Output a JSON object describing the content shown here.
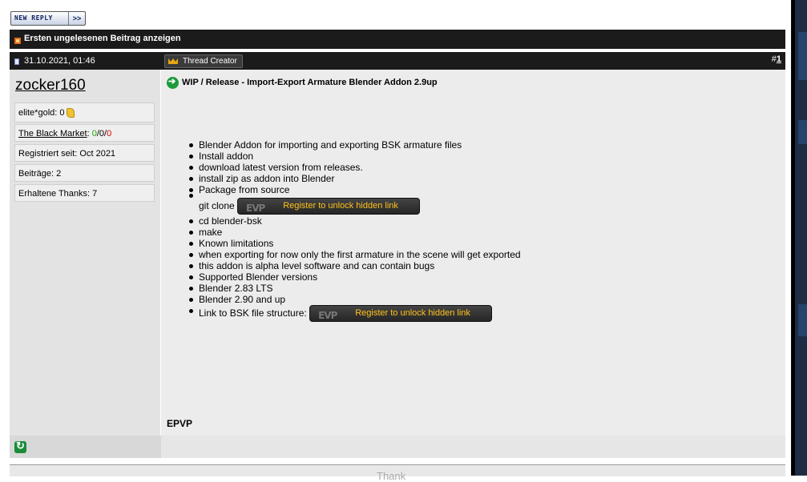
{
  "toolbar": {
    "new_reply_label": "NEW REPLY",
    "new_reply_arrow": ">>"
  },
  "unread_bar": {
    "label": "Ersten ungelesenen Beitrag anzeigen"
  },
  "post": {
    "date": "31.10.2021, 01:46",
    "badge": "Thread Creator",
    "number_prefix": "#",
    "number": "1",
    "title": "WIP / Release - Import-Export Armature Blender Addon 2.9up",
    "signature": "EPVP"
  },
  "user": {
    "name": "zocker160",
    "gold": "elite*gold: 0",
    "black_market_label": "The Black Market",
    "black_market_sep": ": ",
    "bm_positive": "0",
    "bm_neutral": "0",
    "bm_negative": "0",
    "slash": "/",
    "registered": "Registriert seit: Oct 2021",
    "posts": "Beiträge: 2",
    "thanks": "Erhaltene Thanks: 7"
  },
  "bullets": [
    "Blender Addon for importing and exporting BSK armature files",
    "Install addon",
    "download latest version from releases.",
    "install zip as addon into Blender",
    "Package from source",
    "git clone",
    "cd blender-bsk",
    "make",
    "Known limitations",
    "when exporting for now only the first armature in the scene will get exported",
    "this addon is alpha level software and can contain bugs",
    "Supported Blender versions",
    "Blender 2.83 LTS",
    "Blender 2.90 and up",
    "Link to BSK file structure:"
  ],
  "hidden_link": {
    "logo": "EVP",
    "label": "Register to unlock hidden link"
  },
  "thanks_bar": {
    "label": "Thank"
  }
}
